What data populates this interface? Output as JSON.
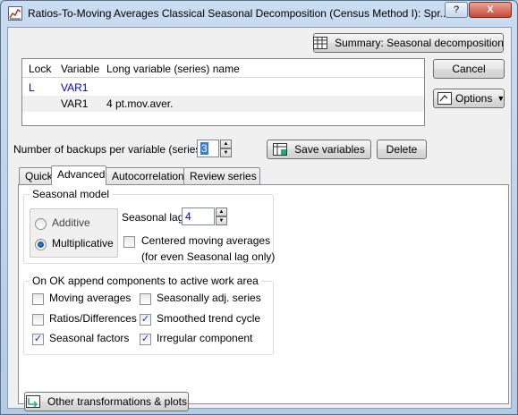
{
  "window": {
    "title": "Ratios-To-Moving Averages Classical Seasonal Decomposition (Census Method I): Spr...",
    "help_label": "?",
    "close_label": "X"
  },
  "summary_button": "Summary:  Seasonal decomposition",
  "cancel_button": "Cancel",
  "options_button": "Options",
  "variables_table": {
    "headers": [
      "Lock",
      "Variable",
      "Long variable (series) name"
    ],
    "rows": [
      {
        "lock": "L",
        "variable": "VAR1",
        "long_name": ""
      },
      {
        "lock": "",
        "variable": "VAR1",
        "long_name": "4 pt.mov.aver."
      }
    ]
  },
  "backups": {
    "label": "Number of backups per variable (series):",
    "value": "3"
  },
  "save_variables_button": "Save variables",
  "delete_button": "Delete",
  "tabs": [
    "Quick",
    "Advanced",
    "Autocorrelations",
    "Review series"
  ],
  "active_tab": "Advanced",
  "seasonal_model": {
    "title": "Seasonal model",
    "additive": "Additive",
    "multiplicative": "Multiplicative",
    "selected": "Multiplicative",
    "seasonal_lag_label": "Seasonal lag:",
    "seasonal_lag_value": "4",
    "centered_label": "Centered moving averages",
    "centered_note": "(for even Seasonal lag only)",
    "centered_checked": false
  },
  "append_components": {
    "title": "On OK append components to active work area",
    "items": [
      {
        "label": "Moving averages",
        "checked": false
      },
      {
        "label": "Seasonally adj. series",
        "checked": false
      },
      {
        "label": "Ratios/Differences",
        "checked": false
      },
      {
        "label": "Smoothed trend cycle",
        "checked": true
      },
      {
        "label": "Seasonal factors",
        "checked": true
      },
      {
        "label": "Irregular component",
        "checked": true
      }
    ]
  },
  "other_transformations_button": "Other transformations & plots"
}
